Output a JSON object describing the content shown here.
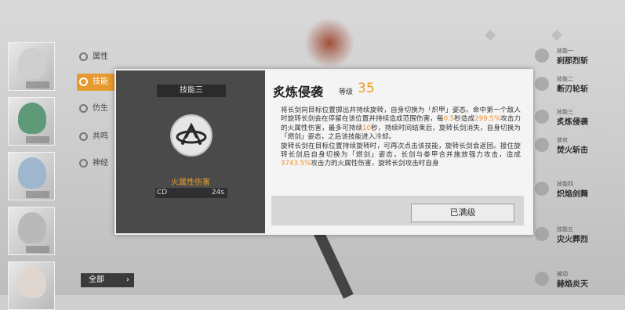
{
  "background": {
    "left_menu": [
      {
        "label": "属性",
        "active": false
      },
      {
        "label": "技能",
        "active": true
      },
      {
        "label": "仿生",
        "active": false
      },
      {
        "label": "共鸣",
        "active": false
      },
      {
        "label": "神经",
        "active": false
      }
    ],
    "filter_button": "全部",
    "right_list": [
      {
        "sub": "技能一",
        "title": "刹那烈斩"
      },
      {
        "sub": "技能二",
        "title": "断刃轮斩"
      },
      {
        "sub": "技能三",
        "title": "炙炼侵袭"
      },
      {
        "sub": "普攻",
        "title": "焚火斩击"
      },
      {
        "sub": "技能四",
        "title": "炽焰剑舞"
      },
      {
        "sub": "技能五",
        "title": "灾火葬烈"
      },
      {
        "sub": "被动",
        "title": "赫焰炎天"
      }
    ]
  },
  "dialog": {
    "tab_label": "技能三",
    "element_type": "火属性伤害",
    "cd_label": "CD",
    "cd_value": "24s",
    "skill_name": "炙炼侵袭",
    "level_label": "等级",
    "level_value": "35",
    "description_p1": [
      {
        "text": "将长剑向目标位置掷出并持续旋转，自身切换为「炽甲」姿态。命中第一个敌人时旋转长剑会在停留在该位置并持续造成范围伤害，每",
        "hl": false
      },
      {
        "text": "0.5",
        "hl": true
      },
      {
        "text": "秒造成",
        "hl": false
      },
      {
        "text": "299.5%",
        "hl": true
      },
      {
        "text": "攻击力的火属性伤害，最多可持续",
        "hl": false
      },
      {
        "text": "10",
        "hl": true
      },
      {
        "text": "秒，持续时间结束后，旋转长剑消失，自身切换为「燃剑」姿态，之后该技能进入冷却。",
        "hl": false
      }
    ],
    "description_p2": [
      {
        "text": "旋转长剑在目标位置持续旋转时，可再次点击该技能，旋转长剑会返回。接住旋转长剑后自身切换为「燃剑」姿态，长剑与拳甲合并施放强力攻击，造成",
        "hl": false
      },
      {
        "text": "3743.5%",
        "hl": true
      },
      {
        "text": "攻击力的火属性伤害，旋转长剑攻击时自身",
        "hl": false
      }
    ],
    "maxed_button": "已满级"
  },
  "colors": {
    "accent": "#f09a1c",
    "panel_dark": "#4a4a4a",
    "panel_light": "#f4f4f4"
  }
}
